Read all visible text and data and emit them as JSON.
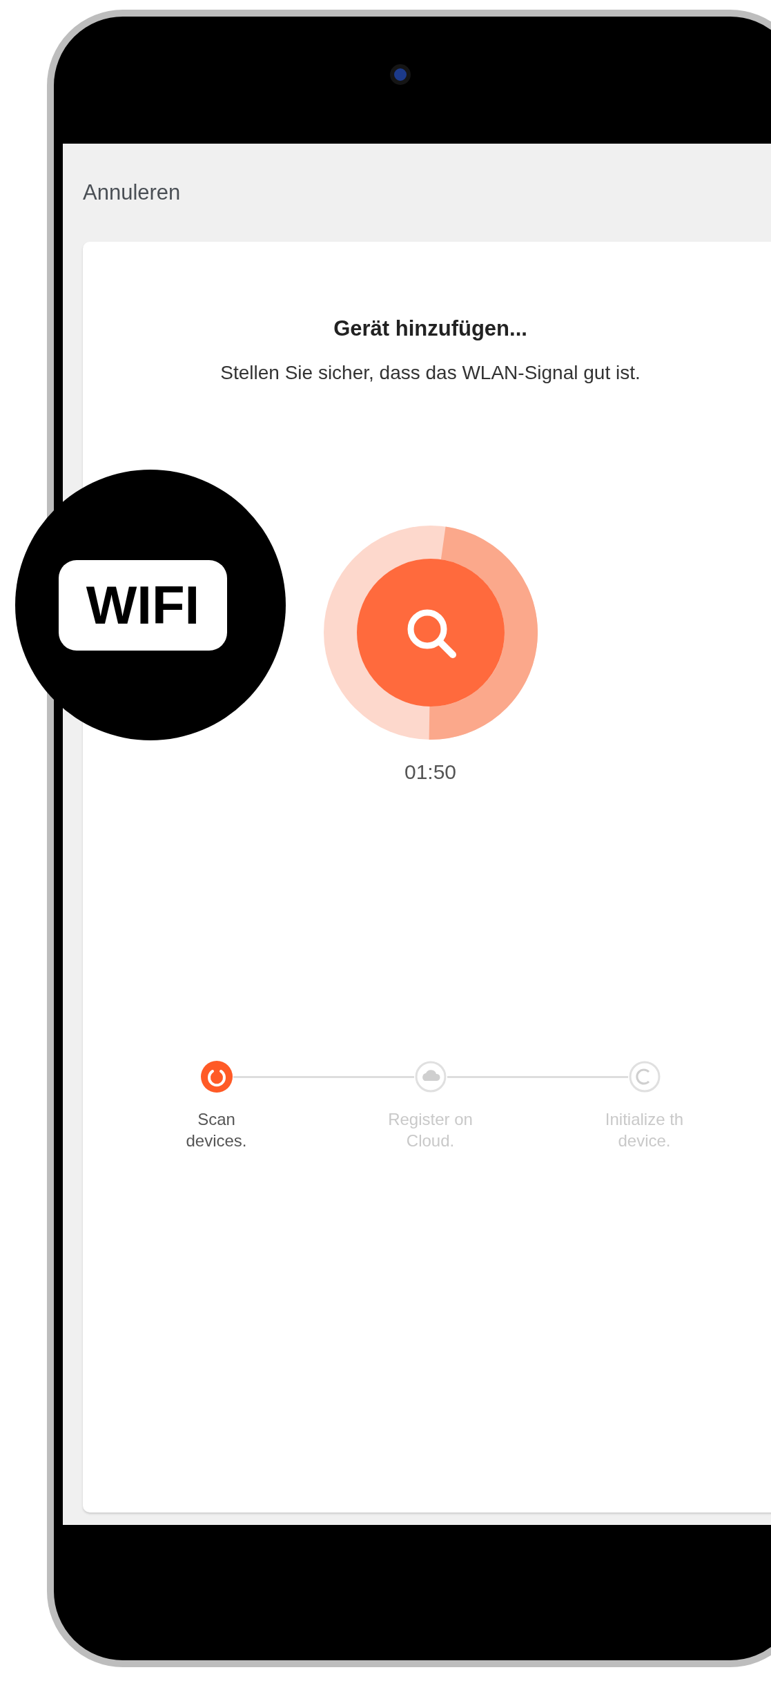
{
  "header": {
    "cancel": "Annuleren"
  },
  "card": {
    "title": "Gerät hinzufügen...",
    "subtitle": "Stellen Sie sicher, dass das WLAN-Signal gut ist."
  },
  "scan": {
    "level": 0.48,
    "timer": "01:50"
  },
  "steps": [
    {
      "label": "Scan devices.",
      "active": true
    },
    {
      "label": "Register on Cloud.",
      "active": false
    },
    {
      "label": "Initialize th device.",
      "active": false
    }
  ],
  "badge": {
    "label": "WIFI"
  }
}
